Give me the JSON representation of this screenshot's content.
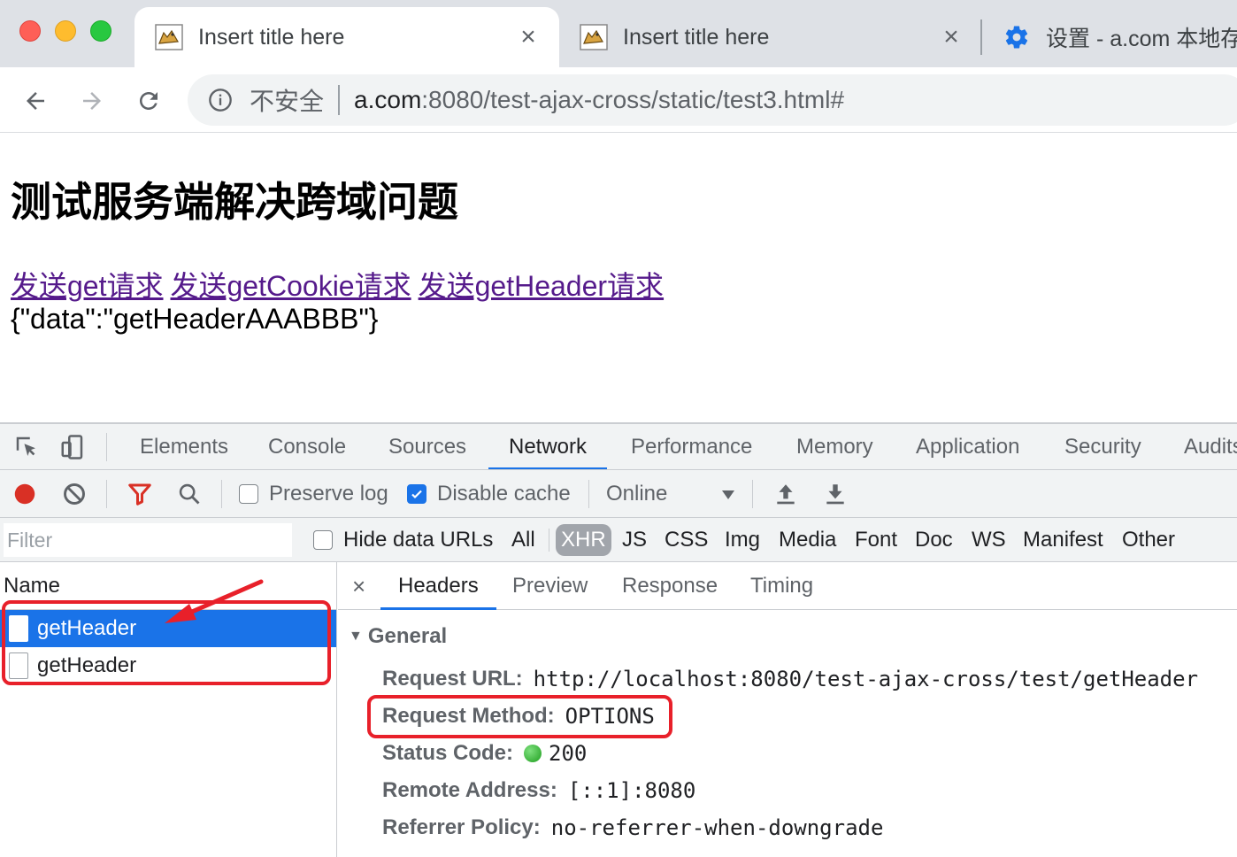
{
  "tabs": [
    {
      "title": "Insert title here",
      "close": "×"
    },
    {
      "title": "Insert title here",
      "close": "×"
    },
    {
      "title": "设置 - a.com 本地存"
    }
  ],
  "omnibox": {
    "security_label": "不安全",
    "url_host": "a.com",
    "url_rest": ":8080/test-ajax-cross/static/test3.html#"
  },
  "page": {
    "heading": "测试服务端解决跨域问题",
    "links": [
      "发送get请求",
      "发送getCookie请求",
      "发送getHeader请求"
    ],
    "output": "{\"data\":\"getHeaderAAABBB\"}"
  },
  "devtools": {
    "tabs": [
      "Elements",
      "Console",
      "Sources",
      "Network",
      "Performance",
      "Memory",
      "Application",
      "Security",
      "Audits"
    ],
    "active_tab": "Network",
    "controls": {
      "preserve_log": "Preserve log",
      "preserve_log_checked": false,
      "disable_cache": "Disable cache",
      "disable_cache_checked": true,
      "throttling": "Online"
    },
    "filter": {
      "placeholder": "Filter",
      "hide_data_urls": "Hide data URLs",
      "types": [
        "All",
        "XHR",
        "JS",
        "CSS",
        "Img",
        "Media",
        "Font",
        "Doc",
        "WS",
        "Manifest",
        "Other"
      ],
      "selected_type": "XHR"
    },
    "requests": {
      "column_name": "Name",
      "rows": [
        "getHeader",
        "getHeader"
      ],
      "selected_index": 0
    },
    "detail": {
      "close": "×",
      "tabs": [
        "Headers",
        "Preview",
        "Response",
        "Timing"
      ],
      "active_tab": "Headers",
      "section": "General",
      "general": [
        {
          "key": "Request URL:",
          "value": "http://localhost:8080/test-ajax-cross/test/getHeader"
        },
        {
          "key": "Request Method:",
          "value": "OPTIONS"
        },
        {
          "key": "Status Code:",
          "value": "200"
        },
        {
          "key": "Remote Address:",
          "value": "[::1]:8080"
        },
        {
          "key": "Referrer Policy:",
          "value": "no-referrer-when-downgrade"
        }
      ]
    }
  },
  "colors": {
    "accent": "#1a73e8",
    "annotation": "#e8202a",
    "visited_link": "#551a8b",
    "status_ok": "#1e9e1e"
  }
}
